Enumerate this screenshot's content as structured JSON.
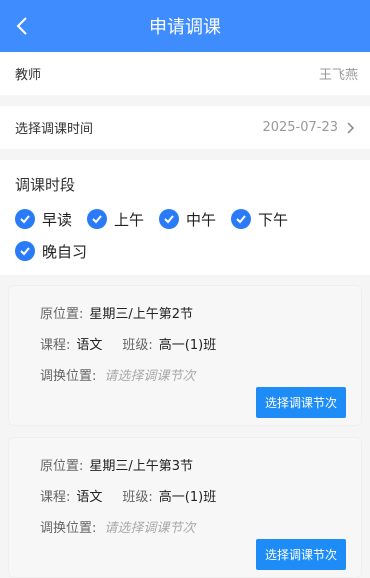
{
  "header": {
    "title": "申请调课"
  },
  "teacher": {
    "label": "教师",
    "value": "王飞燕"
  },
  "date": {
    "label": "选择调课时间",
    "value": "2025-07-23"
  },
  "period": {
    "label": "调课时段",
    "options": [
      {
        "label": "早读",
        "checked": true
      },
      {
        "label": "上午",
        "checked": true
      },
      {
        "label": "中午",
        "checked": true
      },
      {
        "label": "下午",
        "checked": true
      },
      {
        "label": "晚自习",
        "checked": true
      }
    ]
  },
  "cards": [
    {
      "orig_label": "原位置:",
      "orig_value": "星期三/上午第2节",
      "course_label": "课程:",
      "course_value": "语文",
      "class_label": "班级:",
      "class_value": "高一(1)班",
      "swap_label": "调换位置:",
      "swap_placeholder": "请选择调课节次",
      "button": "选择调课节次"
    },
    {
      "orig_label": "原位置:",
      "orig_value": "星期三/上午第3节",
      "course_label": "课程:",
      "course_value": "语文",
      "class_label": "班级:",
      "class_value": "高一(1)班",
      "swap_label": "调换位置:",
      "swap_placeholder": "请选择调课节次",
      "button": "选择调课节次"
    }
  ],
  "colors": {
    "header": "#3f8cff",
    "accent": "#2a7bf7",
    "button": "#1e8cf7"
  }
}
